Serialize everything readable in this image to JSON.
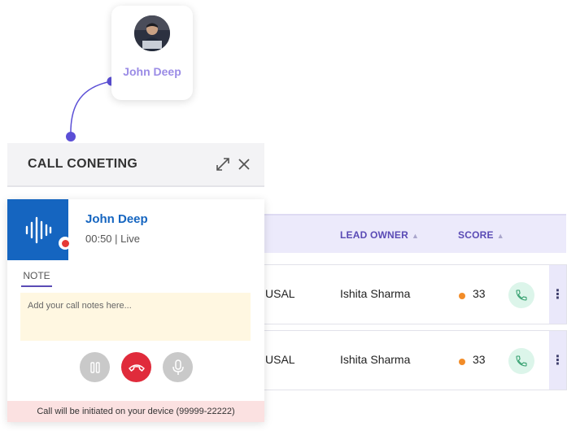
{
  "contact": {
    "name": "John Deep",
    "avatar_icon": "user-photo"
  },
  "call_panel": {
    "title": "CALL CONETING",
    "expand_icon": "expand-icon",
    "close_icon": "close-icon",
    "caller_name": "John Deep",
    "duration": "00:50",
    "status": "Live",
    "note_tab": "NOTE",
    "note_placeholder": "Add your call notes here...",
    "footer": "Call will be initiated on your device (99999-22222)",
    "colors": {
      "accent": "#1565c0",
      "hangup": "#e53935",
      "muted_button": "#c7c7c7"
    }
  },
  "table": {
    "columns": [
      {
        "label": "LEAD OWNER"
      },
      {
        "label": "SCORE"
      }
    ],
    "rows": [
      {
        "partial_cell": "USAL",
        "lead_owner": "Ishita Sharma",
        "score": "33"
      },
      {
        "partial_cell": "USAL",
        "lead_owner": "Ishita Sharma",
        "score": "33"
      }
    ]
  }
}
